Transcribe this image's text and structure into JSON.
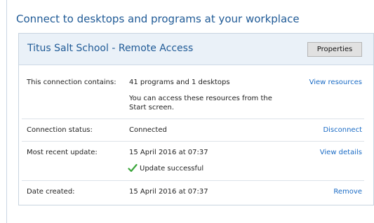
{
  "page": {
    "heading": "Connect to desktops and programs at your workplace"
  },
  "panel": {
    "title": "Titus Salt School - Remote Access",
    "properties_label": "Properties"
  },
  "rows": {
    "contains": {
      "label": "This connection contains:",
      "value": "41 programs and 1 desktops",
      "note": "You can access these resources from the Start screen.",
      "link": "View resources"
    },
    "status": {
      "label": "Connection status:",
      "value": "Connected",
      "link": "Disconnect"
    },
    "update": {
      "label": "Most recent update:",
      "value": "15 April 2016 at 07:37",
      "result": "Update successful",
      "link": "View details"
    },
    "created": {
      "label": "Date created:",
      "value": "15 April 2016 at 07:37",
      "link": "Remove"
    }
  },
  "icons": {
    "check": "checkmark-icon"
  },
  "colors": {
    "heading": "#1f5a96",
    "link": "#1a6bc5",
    "header_bg": "#eaf1f8",
    "check": "#3aa53a"
  }
}
